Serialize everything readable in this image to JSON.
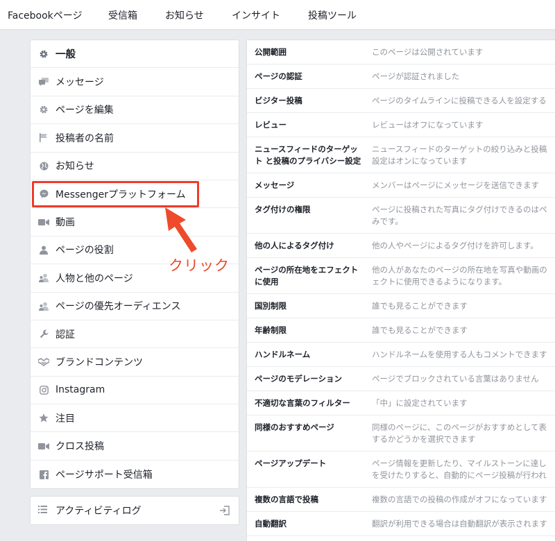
{
  "topnav": {
    "tabs": [
      "Facebookページ",
      "受信箱",
      "お知らせ",
      "インサイト",
      "投稿ツール"
    ]
  },
  "sidebar": {
    "items": [
      {
        "label": "一般",
        "icon": "gear-icon",
        "active": true
      },
      {
        "label": "メッセージ",
        "icon": "chat-bubbles-icon"
      },
      {
        "label": "ページを編集",
        "icon": "gear-icon"
      },
      {
        "label": "投稿者の名前",
        "icon": "flag-icon"
      },
      {
        "label": "お知らせ",
        "icon": "globe-icon"
      },
      {
        "label": "Messengerプラットフォーム",
        "icon": "messenger-icon"
      },
      {
        "label": "動画",
        "icon": "video-camera-icon"
      },
      {
        "label": "ページの役割",
        "icon": "person-icon"
      },
      {
        "label": "人物と他のページ",
        "icon": "people-icon"
      },
      {
        "label": "ページの優先オーディエンス",
        "icon": "people-icon"
      },
      {
        "label": "認証",
        "icon": "wrench-icon"
      },
      {
        "label": "ブランドコンテンツ",
        "icon": "handshake-icon"
      },
      {
        "label": "Instagram",
        "icon": "instagram-icon"
      },
      {
        "label": "注目",
        "icon": "star-icon"
      },
      {
        "label": "クロス投稿",
        "icon": "video-camera-icon"
      },
      {
        "label": "ページサポート受信箱",
        "icon": "facebook-icon"
      }
    ]
  },
  "activity_log": {
    "label": "アクティビティログ",
    "icon": "list-icon",
    "exit_icon": "exit-icon"
  },
  "annotation": {
    "text": "クリック",
    "color": "#ea4b26",
    "box_color": "#ee3b2a"
  },
  "settings": {
    "rows": [
      {
        "name": [
          "公開範囲"
        ],
        "value": [
          "このページは公開されています"
        ]
      },
      {
        "name": [
          "ページの認証"
        ],
        "value": [
          "ページが認証されました"
        ]
      },
      {
        "name": [
          "ビジター投稿"
        ],
        "value": [
          "ページのタイムラインに投稿できる人を設定する"
        ]
      },
      {
        "name": [
          "レビュー"
        ],
        "value": [
          "レビューはオフになっています"
        ]
      },
      {
        "name": [
          "ニュースフィードのターゲッ",
          "ト と投稿のプライバシー設定"
        ],
        "value": [
          "ニュースフィードのターゲットの絞り込みと投稿",
          "設定はオンになっています"
        ]
      },
      {
        "name": [
          "メッセージ"
        ],
        "value": [
          "メンバーはページにメッセージを送信できます"
        ]
      },
      {
        "name": [
          "タグ付けの権限"
        ],
        "value": [
          "ページに投稿された写真にタグ付けできるのはペ",
          "みです。"
        ]
      },
      {
        "name": [
          "他の人によるタグ付け"
        ],
        "value": [
          "他の人やページによるタグ付けを許可します。"
        ]
      },
      {
        "name": [
          "ページの所在地をエフェクト",
          "に使用"
        ],
        "value": [
          "他の人があなたのページの所在地を写真や動画の",
          "ェクトに使用できるようになります。"
        ]
      },
      {
        "name": [
          "国別制限"
        ],
        "value": [
          "誰でも見ることができます"
        ]
      },
      {
        "name": [
          "年齢制限"
        ],
        "value": [
          "誰でも見ることができます"
        ]
      },
      {
        "name": [
          "ハンドルネーム"
        ],
        "value": [
          "ハンドルネームを使用する人もコメントできます"
        ]
      },
      {
        "name": [
          "ページのモデレーション"
        ],
        "value": [
          "ページでブロックされている言葉はありません"
        ]
      },
      {
        "name": [
          "不適切な言葉のフィルター"
        ],
        "value": [
          "「中」に設定されています"
        ]
      },
      {
        "name": [
          "同様のおすすめページ"
        ],
        "value": [
          "同様のページに、このページがおすすめとして表",
          "するかどうかを選択できます"
        ]
      },
      {
        "name": [
          "ページアップデート"
        ],
        "value": [
          "ページ情報を更新したり、マイルストーンに達し",
          "を受けたりすると、自動的にページ投稿が行われ"
        ]
      },
      {
        "name": [
          "複数の言語で投稿"
        ],
        "value": [
          "複数の言語での投稿の作成がオフになっています"
        ]
      },
      {
        "name": [
          "自動翻訳"
        ],
        "value": [
          "翻訳が利用できる場合は自動翻訳が表示されます"
        ]
      }
    ]
  }
}
